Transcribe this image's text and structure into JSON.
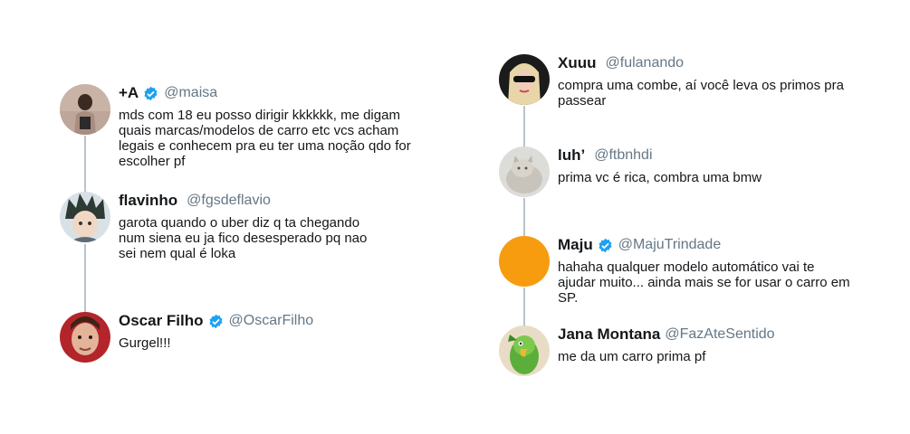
{
  "colors": {
    "verified": "#1da1f2",
    "connector": "#b9c3cc",
    "handle": "#657786"
  },
  "left_thread": [
    {
      "name": "+A",
      "verified": true,
      "handle": "@maisa",
      "text": "mds com 18 eu posso dirigir kkkkkk, me digam quais marcas/modelos de carro etc vcs acham legais e conhecem pra eu ter uma noção qdo for escolher pf"
    },
    {
      "name": "flavinho",
      "verified": false,
      "handle": "@fgsdeflavio",
      "text": "garota quando o uber diz q ta chegando num siena eu ja fico desesperado pq nao sei nem qual é loka"
    },
    {
      "name": "Oscar Filho",
      "verified": true,
      "handle": "@OscarFilho",
      "text": "Gurgel!!!"
    }
  ],
  "right_thread": [
    {
      "name": "Xuuu",
      "verified": false,
      "handle": "@fulanando",
      "text": "compra uma combe, aí você leva os primos pra passear"
    },
    {
      "name": "luh’",
      "verified": false,
      "handle": "@ftbnhdi",
      "text": "prima vc é rica, combra uma bmw"
    },
    {
      "name": "Maju",
      "verified": true,
      "handle": "@MajuTrindade",
      "text": "hahaha qualquer modelo automático vai te ajudar muito... ainda mais se for usar o carro em SP."
    },
    {
      "name": "Jana Montana",
      "verified": false,
      "handle": "@FazAteSentido",
      "text": "me da um carro prima pf"
    }
  ]
}
